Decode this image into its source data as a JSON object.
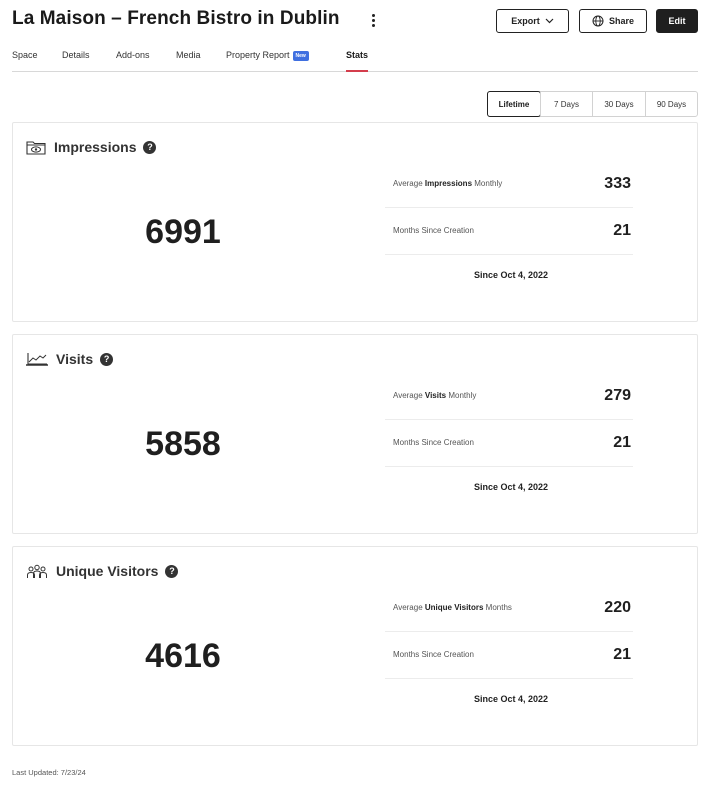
{
  "header": {
    "title": "La Maison – French Bistro in Dublin",
    "export_label": "Export",
    "share_label": "Share",
    "edit_label": "Edit"
  },
  "tabs": [
    {
      "label": "Space"
    },
    {
      "label": "Details"
    },
    {
      "label": "Add-ons"
    },
    {
      "label": "Media"
    },
    {
      "label": "Property Report",
      "badge": "New"
    },
    {
      "label": "Stats",
      "active": true
    }
  ],
  "range": {
    "options": [
      "Lifetime",
      "7 Days",
      "30 Days",
      "90 Days"
    ],
    "selected": "Lifetime"
  },
  "cards": {
    "impressions": {
      "title": "Impressions",
      "icon": "eye-folder-icon",
      "total": "6991",
      "avg_prefix": "Average",
      "avg_bold": "Impressions",
      "avg_suffix": "Monthly",
      "avg_value": "333",
      "months_label": "Months Since Creation",
      "months_value": "21",
      "since": "Since Oct 4, 2022"
    },
    "visits": {
      "title": "Visits",
      "icon": "trend-chart-icon",
      "total": "5858",
      "avg_prefix": "Average",
      "avg_bold": "Visits",
      "avg_suffix": "Monthly",
      "avg_value": "279",
      "months_label": "Months Since Creation",
      "months_value": "21",
      "since": "Since Oct 4, 2022"
    },
    "unique_visitors": {
      "title": "Unique Visitors",
      "icon": "people-group-icon",
      "total": "4616",
      "avg_prefix": "Average",
      "avg_bold": "Unique Visitors",
      "avg_suffix": "Months",
      "avg_value": "220",
      "months_label": "Months Since Creation",
      "months_value": "21",
      "since": "Since Oct 4, 2022"
    }
  },
  "footer": {
    "last_updated": "Last Updated: 7/23/24"
  },
  "colors": {
    "accent_tab_underline": "#d43d4c",
    "badge_new": "#3f6fe0",
    "edit_button": "#1f1f1f"
  }
}
